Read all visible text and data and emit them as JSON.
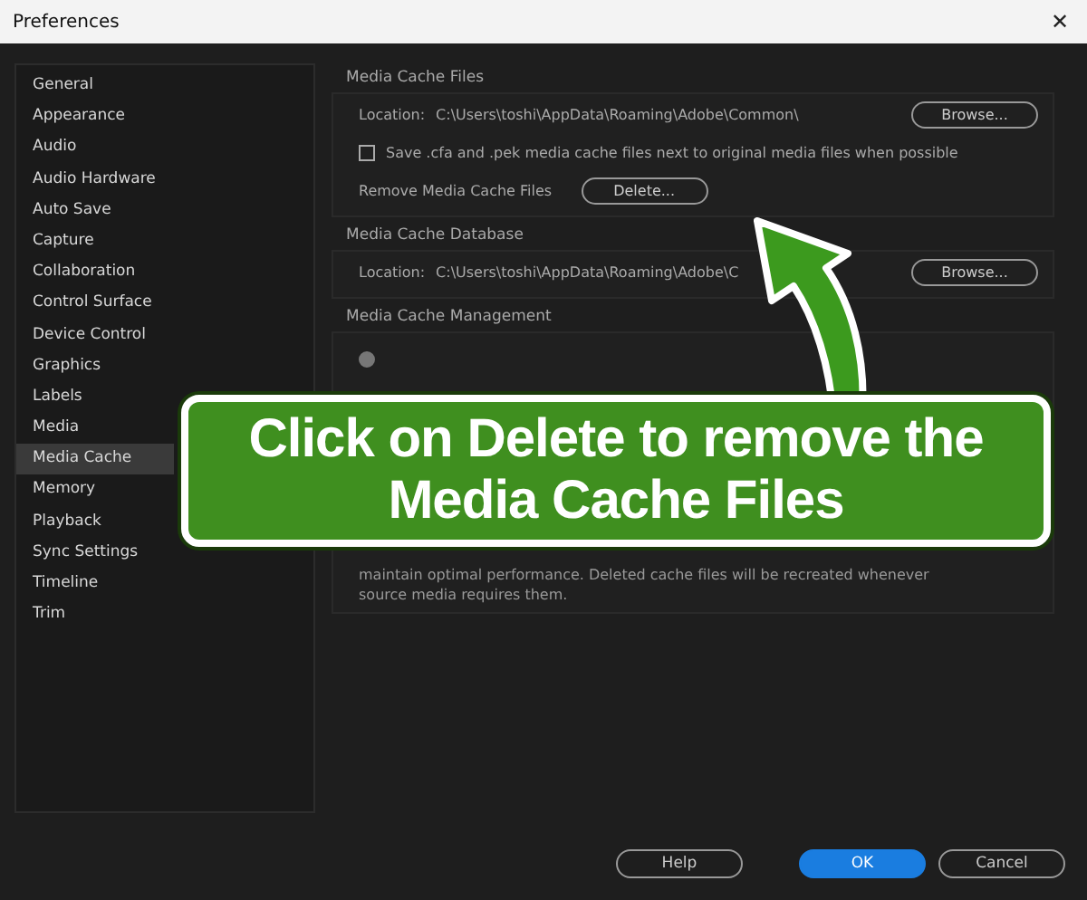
{
  "window": {
    "title": "Preferences",
    "close": "✕"
  },
  "sidebar": {
    "items": [
      {
        "label": "General",
        "selected": false
      },
      {
        "label": "Appearance",
        "selected": false
      },
      {
        "label": "Audio",
        "selected": false
      },
      {
        "label": "Audio Hardware",
        "selected": false
      },
      {
        "label": "Auto Save",
        "selected": false
      },
      {
        "label": "Capture",
        "selected": false
      },
      {
        "label": "Collaboration",
        "selected": false
      },
      {
        "label": "Control Surface",
        "selected": false
      },
      {
        "label": "Device Control",
        "selected": false
      },
      {
        "label": "Graphics",
        "selected": false
      },
      {
        "label": "Labels",
        "selected": false
      },
      {
        "label": "Media",
        "selected": false
      },
      {
        "label": "Media Cache",
        "selected": true
      },
      {
        "label": "Memory",
        "selected": false
      },
      {
        "label": "Playback",
        "selected": false
      },
      {
        "label": "Sync Settings",
        "selected": false
      },
      {
        "label": "Timeline",
        "selected": false
      },
      {
        "label": "Trim",
        "selected": false
      }
    ]
  },
  "media_cache_files": {
    "title": "Media Cache Files",
    "location_label": "Location:",
    "location": "C:\\Users\\toshi\\AppData\\Roaming\\Adobe\\Common\\",
    "browse": "Browse...",
    "save_option": {
      "label": "Save .cfa and .pek media cache files next to original media files when possible",
      "checked": false
    },
    "remove_label": "Remove Media Cache Files",
    "delete": "Delete..."
  },
  "media_cache_database": {
    "title": "Media Cache Database",
    "location_label": "Location:",
    "location": "C:\\Users\\toshi\\AppData\\Roaming\\Adobe\\C",
    "browse": "Browse..."
  },
  "media_cache_management": {
    "title": "Media Cache Management",
    "radio": {
      "selected": true
    },
    "note_lines": [
      "maintain optimal performance. Deleted cache files will be recreated whenever",
      "source media requires them."
    ]
  },
  "callout": {
    "lines": [
      "Click on Delete to remove the",
      "Media Cache Files"
    ]
  },
  "buttons": [
    {
      "label": "Help",
      "primary": false
    },
    {
      "label": "OK",
      "primary": true
    },
    {
      "label": "Cancel",
      "primary": false
    }
  ]
}
